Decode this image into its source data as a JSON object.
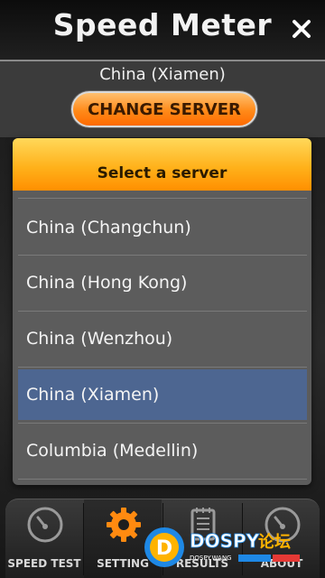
{
  "header": {
    "title": "Speed Meter",
    "close_icon": "close-icon"
  },
  "server_panel": {
    "current_server": "China (Xiamen)",
    "change_button_label": "CHANGE SERVER"
  },
  "dialog": {
    "title": "Select a server",
    "items": [
      {
        "label": "China (Changchun)",
        "selected": false
      },
      {
        "label": "China (Hong Kong)",
        "selected": false
      },
      {
        "label": "China (Wenzhou)",
        "selected": false
      },
      {
        "label": "China (Xiamen)",
        "selected": true
      },
      {
        "label": "Columbia (Medellin)",
        "selected": false
      }
    ]
  },
  "nav": {
    "tabs": [
      {
        "label": "SPEED TEST",
        "icon": "speedometer-icon",
        "active": false
      },
      {
        "label": "SETTING",
        "icon": "gear-icon",
        "active": true
      },
      {
        "label": "RESULTS",
        "icon": "notepad-icon",
        "active": false
      },
      {
        "label": "ABOUT",
        "icon": "speedometer-icon",
        "active": false
      }
    ]
  },
  "watermark": {
    "brand": "DOSPY",
    "brand_cn": "论坛",
    "sub": "DOSPY.WANG"
  },
  "colors": {
    "accent_orange": "#ff8a19",
    "selected_row": "#4d6691",
    "dialog_bg": "#5c5c5c"
  }
}
